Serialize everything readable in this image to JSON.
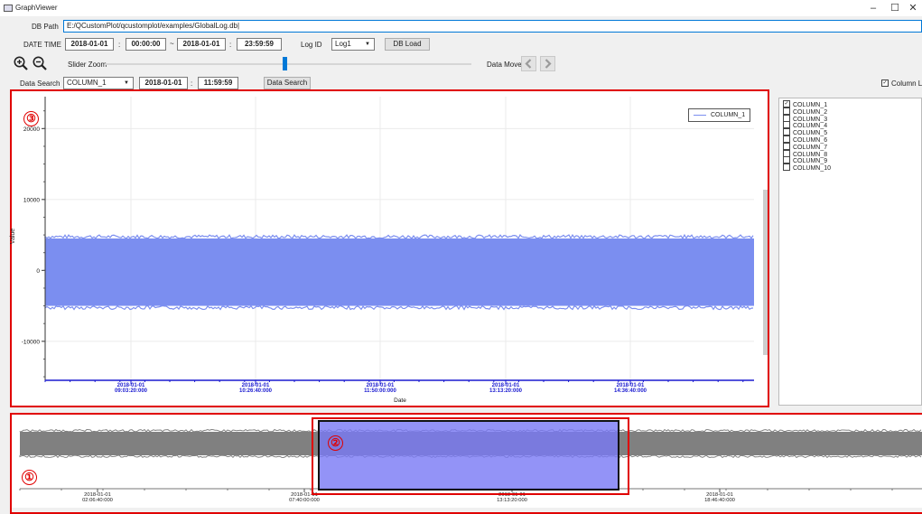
{
  "window": {
    "title": "GraphViewer",
    "minimize": "–",
    "maximize": "☐",
    "close": "✕"
  },
  "db_path": {
    "label": "DB Path",
    "value": "E:/QCustomPlot/qcustomplot/examples/GlobalLog.db|"
  },
  "datetime": {
    "label": "DATE TIME",
    "start_date": "2018-01-01",
    "start_time": "00:00:00",
    "range_sep": "~",
    "end_date": "2018-01-01",
    "end_time": "23:59:59",
    "colon": ":"
  },
  "log_id": {
    "label": "Log ID",
    "value": "Log1"
  },
  "db_load_button": "DB Load",
  "slider_zoom": {
    "label": "Slider Zoom",
    "position": 0.49
  },
  "data_move": {
    "label": "Data Move"
  },
  "data_search": {
    "label": "Data Search",
    "column": "COLUMN_1",
    "date": "2018-01-01",
    "time": "11:59:59",
    "button": "Data Search"
  },
  "column_list_toggle": {
    "label": "Column List",
    "checked": true
  },
  "columns": [
    {
      "name": "COLUMN_1",
      "checked": true
    },
    {
      "name": "COLUMN_2",
      "checked": false
    },
    {
      "name": "COLUMN_3",
      "checked": false
    },
    {
      "name": "COLUMN_4",
      "checked": false
    },
    {
      "name": "COLUMN_5",
      "checked": false
    },
    {
      "name": "COLUMN_6",
      "checked": false
    },
    {
      "name": "COLUMN_7",
      "checked": false
    },
    {
      "name": "COLUMN_8",
      "checked": false
    },
    {
      "name": "COLUMN_9",
      "checked": false
    },
    {
      "name": "COLUMN_10",
      "checked": false
    }
  ],
  "annotations": {
    "overview": "①",
    "selection": "②",
    "main": "③"
  },
  "colors": {
    "series": "#7b8ef0",
    "overview_series": "#808080",
    "selection_fill": "#8c8cf5",
    "highlight": "#e00000",
    "slider": "#0078d7"
  },
  "chart_data": {
    "type": "area",
    "ylabel": "Value",
    "xlabel": "Date",
    "ylim": [
      -15500,
      24500
    ],
    "yticks": [
      -10000,
      0,
      10000,
      20000
    ],
    "ytick_labels": [
      "-10000",
      "0",
      "10000",
      "20000"
    ],
    "band": {
      "upper": 4500,
      "lower": -5000
    },
    "xtick_labels": [
      [
        "2018-01-01",
        "09:03:20:000"
      ],
      [
        "2018-01-01",
        "10:26:40:000"
      ],
      [
        "2018-01-01",
        "11:50:00:000"
      ],
      [
        "2018-01-01",
        "13:13:20:000"
      ],
      [
        "2018-01-01",
        "14:36:40:000"
      ]
    ],
    "series": [
      {
        "name": "COLUMN_1"
      }
    ],
    "legend": "top-right",
    "overview_xtick_labels": [
      [
        "2018-01-01",
        "02:06:40:000"
      ],
      [
        "2018-01-01",
        "07:40:00:000"
      ],
      [
        "2018-01-01",
        "13:13:20:000"
      ],
      [
        "2018-01-01",
        "18:46:40:000"
      ]
    ]
  }
}
